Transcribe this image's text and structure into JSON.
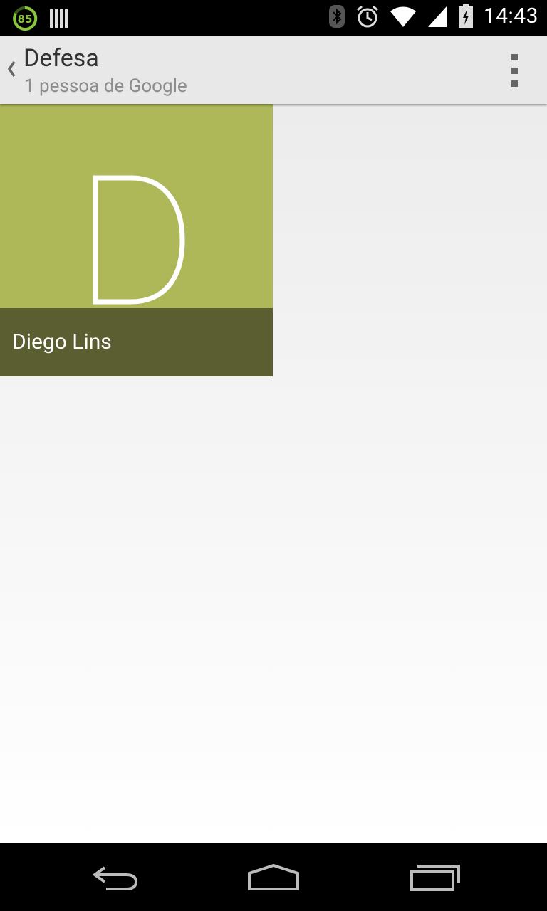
{
  "status_bar": {
    "battery_ring_value": "85",
    "time": "14:43",
    "icons": [
      "battery-percent-ring-icon",
      "barcode-icon",
      "bluetooth-icon",
      "alarm-icon",
      "wifi-icon",
      "signal-icon",
      "battery-icon"
    ]
  },
  "action_bar": {
    "title": "Defesa",
    "subtitle": "1 pessoa de Google",
    "up_icon": "chevron-left-icon",
    "overflow_icon": "overflow-menu-icon"
  },
  "contacts": [
    {
      "name": "Diego Lins",
      "initial": "D",
      "tile_color": "#aeb858",
      "name_bar_color": "#5a5e30"
    }
  ],
  "nav_bar": {
    "icons": [
      "back-icon",
      "home-icon",
      "recents-icon"
    ]
  }
}
